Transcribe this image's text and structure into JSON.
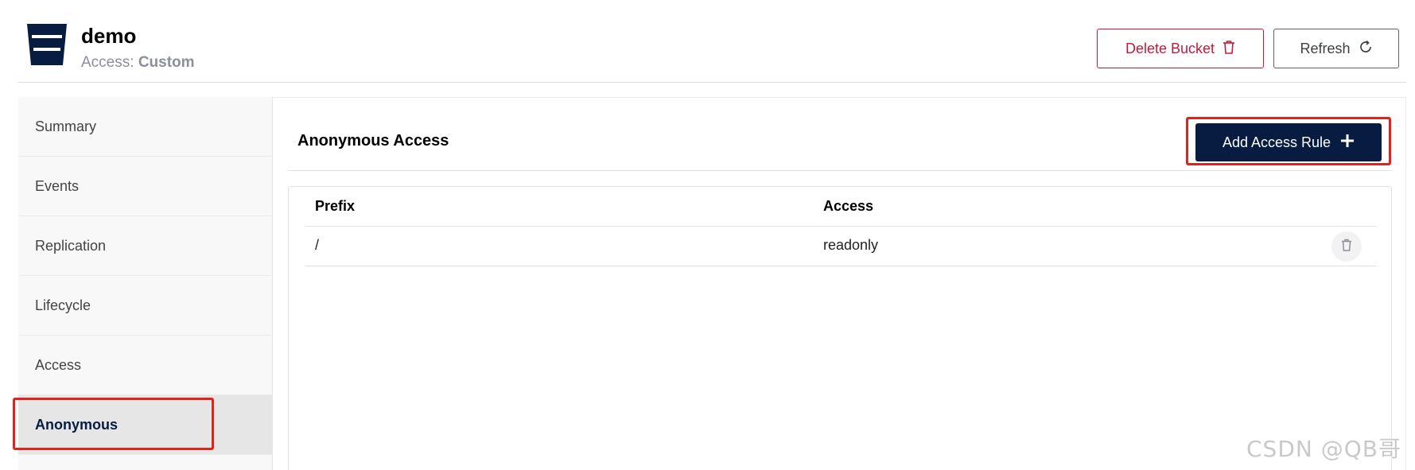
{
  "header": {
    "bucket_name": "demo",
    "access_label": "Access:",
    "access_value": "Custom",
    "delete_button": "Delete Bucket",
    "refresh_button": "Refresh"
  },
  "sidebar": {
    "items": [
      {
        "label": "Summary",
        "active": false
      },
      {
        "label": "Events",
        "active": false
      },
      {
        "label": "Replication",
        "active": false
      },
      {
        "label": "Lifecycle",
        "active": false
      },
      {
        "label": "Access",
        "active": false
      },
      {
        "label": "Anonymous",
        "active": true
      }
    ]
  },
  "main": {
    "section_title": "Anonymous Access",
    "add_button": "Add Access Rule",
    "table": {
      "columns": [
        "Prefix",
        "Access"
      ],
      "rows": [
        {
          "prefix": "/",
          "access": "readonly"
        }
      ]
    }
  },
  "watermark": "CSDN @QB哥",
  "colors": {
    "brand_navy": "#081c42",
    "danger": "#c51b3b",
    "highlight": "#e0241b"
  }
}
